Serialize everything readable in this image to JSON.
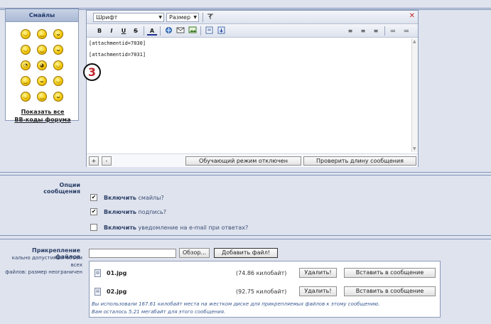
{
  "smilies": {
    "title": "Смайлы",
    "faces": [
      "◡",
      "‿",
      "ᴗ",
      "◡",
      "‿",
      "ᴗ",
      "◔",
      "◕",
      "◡",
      "‿",
      "ᴗ",
      "◡",
      "◡",
      "‿",
      "ᴗ"
    ],
    "link1": "Показать все",
    "link2": "BB-коды форума"
  },
  "editor": {
    "font_select": "Шрифт",
    "size_select": "Размер",
    "toolbar": {
      "bold": "B",
      "italic": "I",
      "underline": "U",
      "strike": "S",
      "color": "A",
      "align_left": "≡",
      "align_center": "≡",
      "align_right": "≡",
      "olist": "≔",
      "ulist": "≔"
    },
    "lines": [
      "[attachmentid=7030]",
      "[attachmentid=7031]"
    ],
    "plus": "+",
    "minus": "-",
    "training_mode": "Обучающий режим отключен",
    "check_length": "Проверить длину сообщения"
  },
  "badge": "3",
  "options": {
    "label": "Опции сообщения",
    "items": [
      {
        "bold": "Включить",
        "text": " смайлы?",
        "checked": "✔"
      },
      {
        "bold": "Включить",
        "text": " подпись?",
        "checked": "✔"
      },
      {
        "bold": "Включить",
        "text": " уведомление на e-mail при ответах?",
        "checked": ""
      }
    ]
  },
  "attachments": {
    "label": "Прикрепление файлов",
    "note1": "кально допустимый объем всех",
    "note2": "файлов: размер неограничен",
    "browse": "Обзор...",
    "add_file": "Добавить файл!",
    "files": [
      {
        "name": "01.jpg",
        "size": "(74.86 килобайт)",
        "delete": "Удалить!",
        "insert": "Вставить в сообщение"
      },
      {
        "name": "02.jpg",
        "size": "(92.75 килобайт)",
        "delete": "Удалить!",
        "insert": "Вставить в сообщение"
      }
    ],
    "used": "Вы использовали 167.61 килобайт места на жестком диске для прикрепляемых файлов к этому сообщению.",
    "remaining": "Вам осталось 5.21 мегабайт для этого сообщения."
  }
}
